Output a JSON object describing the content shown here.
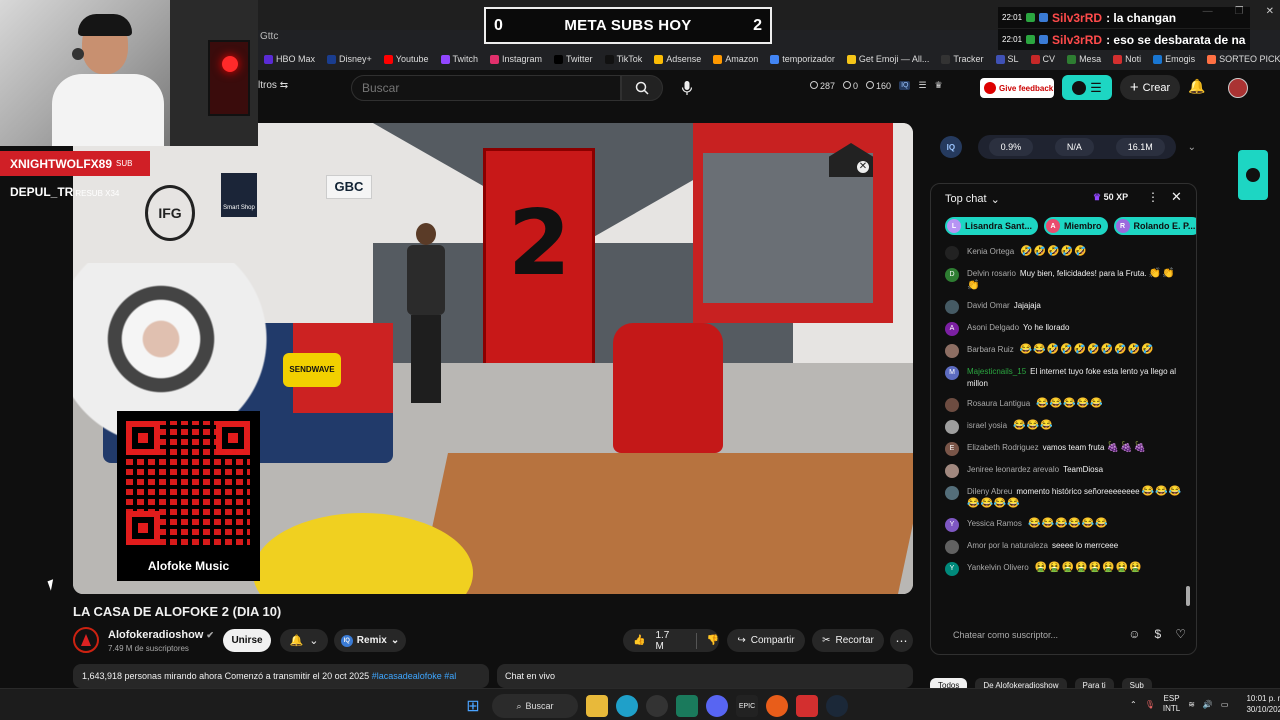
{
  "browser": {
    "tab_title": "Gttc",
    "bookmarks": [
      {
        "label": "HBO Max",
        "color": "#5a2bd6"
      },
      {
        "label": "Disney+",
        "color": "#1a3d8f"
      },
      {
        "label": "Youtube",
        "color": "#ff0000"
      },
      {
        "label": "Twitch",
        "color": "#9146ff"
      },
      {
        "label": "Instagram",
        "color": "#e1306c"
      },
      {
        "label": "Twitter",
        "color": "#000000"
      },
      {
        "label": "TikTok",
        "color": "#111111"
      },
      {
        "label": "Adsense",
        "color": "#fbbc05"
      },
      {
        "label": "Amazon",
        "color": "#ff9900"
      },
      {
        "label": "temporizador",
        "color": "#4285f4"
      },
      {
        "label": "Get Emoji — All...",
        "color": "#f5c518"
      },
      {
        "label": "Tracker",
        "color": "#333333"
      },
      {
        "label": "SL",
        "color": "#3f51b5"
      },
      {
        "label": "CV",
        "color": "#c62828"
      },
      {
        "label": "Mesa",
        "color": "#2e7d32"
      },
      {
        "label": "Noti",
        "color": "#d32f2f"
      },
      {
        "label": "Emogis",
        "color": "#1976d2"
      },
      {
        "label": "SORTEO PICKER",
        "color": "#ff7043"
      }
    ]
  },
  "overlay": {
    "goal_left": "0",
    "goal_title": "META SUBS HOY",
    "goal_right": "2",
    "alerts": [
      {
        "time": "22:01",
        "name": "Silv3rRD",
        "message": ": la changan"
      },
      {
        "time": "22:01",
        "name": "Silv3rRD",
        "message": ": eso se desbarata de na"
      }
    ],
    "sub_name": "XNIGHTWOLFX89",
    "sub_tag": "SUB",
    "resub_name": "DEPUL_TR",
    "resub_tag": "RESUB X34",
    "qr_label": "Alofoke Music"
  },
  "youtube": {
    "filters_label": "ltros",
    "search_placeholder": "Buscar",
    "stats": [
      "287",
      "0",
      "160"
    ],
    "feedback_label": "Give feedback",
    "create_label": "Crear",
    "video_title": "LA CASA DE ALOFOKE 2 (DIA 10)",
    "channel_name": "Alofokeradioshow",
    "channel_subs": "7.49 M de suscriptores",
    "join_label": "Unirse",
    "remix_label": "Remix",
    "like_count": "1.7 M",
    "share_label": "Compartir",
    "clip_label": "Recortar",
    "description": "1,643,918 personas mirando ahora  Comenzó a transmitir el 20 oct 2025",
    "description_tag": "#lacasadealofoke #al",
    "live_chat_label": "Chat en vivo",
    "video_scene": {
      "door_number": "2",
      "gbc_sign": "GBC",
      "ifg_sign": "IFG",
      "smart_sign": "Smart Shop",
      "pillow_text": "SENDWAVE"
    }
  },
  "iq_bar": {
    "badge": "IQ",
    "values": [
      "0.9%",
      "N/A",
      "16.1M"
    ]
  },
  "chat": {
    "header": "Top chat",
    "xp": "50 XP",
    "chips": [
      {
        "label": "Lisandra Sant...",
        "initial": "L"
      },
      {
        "label": "Miembro",
        "initial": "A"
      },
      {
        "label": "Rolando E. P...",
        "initial": "R"
      }
    ],
    "messages": [
      {
        "author": "Kenia Ortega",
        "text": "",
        "emoji": "🤣🤣🤣🤣🤣",
        "color": "#222222",
        "initial": "",
        "member": false
      },
      {
        "author": "Delvin rosario",
        "text": "Muy bien, felicidades! para la Fruta.",
        "emoji": "👏👏👏",
        "color": "#2e7d32",
        "initial": "D",
        "member": false
      },
      {
        "author": "David Omar",
        "text": "Jajajaja",
        "emoji": "",
        "color": "#455a64",
        "initial": "",
        "member": false
      },
      {
        "author": "Asoni Delgado",
        "text": "Yo he llorado",
        "emoji": "",
        "color": "#7b1fa2",
        "initial": "A",
        "member": false
      },
      {
        "author": "Barbara Ruiz",
        "text": "",
        "emoji": "😂😂🤣🤣🤣🤣🤣🤣🤣🤣",
        "color": "#8d6e63",
        "initial": "",
        "member": false
      },
      {
        "author": "Majesticnails_15",
        "text": "El internet tuyo foke esta lento ya llego al millon",
        "emoji": "",
        "color": "#5c6bc0",
        "initial": "M",
        "member": true
      },
      {
        "author": "Rosaura Lantigua",
        "text": "",
        "emoji": "😂😂😂😂😂",
        "color": "#6d4c41",
        "initial": "",
        "member": false
      },
      {
        "author": "israel yosia",
        "text": "",
        "emoji": "😂😂😂",
        "color": "#9e9e9e",
        "initial": "",
        "member": false
      },
      {
        "author": "Elizabeth Rodriguez",
        "text": "vamos team fruta",
        "emoji": "🍇🍇🍇",
        "color": "#795548",
        "initial": "E",
        "member": false
      },
      {
        "author": "Jeniree leonardez arevalo",
        "text": "TeamDiosa",
        "emoji": "",
        "color": "#a1887f",
        "initial": "",
        "member": false
      },
      {
        "author": "Dileny Abreu",
        "text": "momento histórico señoreeeeeeee",
        "emoji": "😂😂😂😂😂😂😂",
        "color": "#546e7a",
        "initial": "",
        "member": false
      },
      {
        "author": "Yessica Ramos",
        "text": "",
        "emoji": "😂😂😂😂😂😂",
        "color": "#7e57c2",
        "initial": "Y",
        "member": false
      },
      {
        "author": "Amor por la naturaleza",
        "text": "seeee lo merrceee",
        "emoji": "",
        "color": "#616161",
        "initial": "",
        "member": false
      },
      {
        "author": "Yankelvin Olivero",
        "text": "",
        "emoji": "🤮🤮🤮🤮🤮🤮🤮🤮",
        "color": "#00897b",
        "initial": "Y",
        "member": false
      }
    ],
    "input_placeholder": "Chatear como suscriptor...",
    "filter_chips": [
      "Todos",
      "De Alofokeradioshow",
      "Para ti",
      "Sub"
    ]
  },
  "taskbar": {
    "search_label": "Buscar",
    "lang_top": "ESP",
    "lang_bottom": "INTL",
    "time": "10:01 p. m.",
    "date": "30/10/2025"
  }
}
